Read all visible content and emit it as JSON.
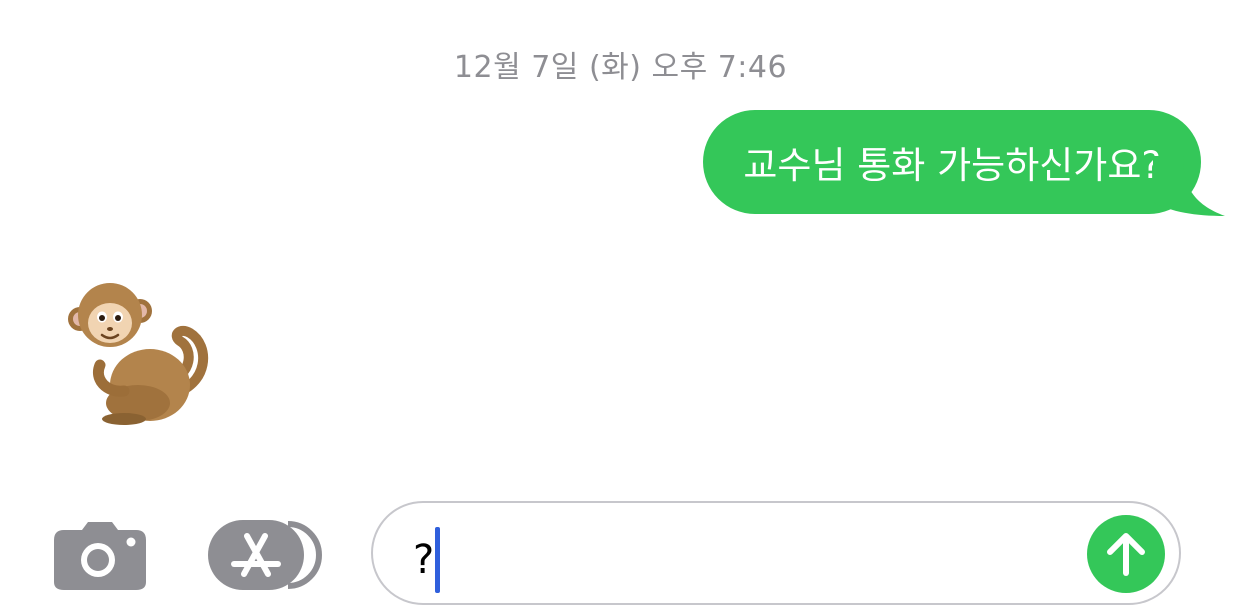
{
  "conversation": {
    "timestamp": "12월 7일 (화) 오후 7:46",
    "messages": [
      {
        "sender": "me",
        "type": "text",
        "text": "교수님 통화 가능하신가요?"
      },
      {
        "sender": "other",
        "type": "emoji",
        "emoji": "monkey"
      }
    ]
  },
  "compose": {
    "input_value": "?",
    "camera_icon": "camera-icon",
    "appstore_icon": "app-store-icon",
    "send_icon": "arrow-up-icon"
  },
  "colors": {
    "bubble_sent": "#34c759",
    "send_button": "#34c759",
    "timestamp_text": "#8e8e93",
    "toolbar_icon": "#8e8e93",
    "input_border": "#c7c7cc",
    "caret": "#2f5fdc"
  }
}
